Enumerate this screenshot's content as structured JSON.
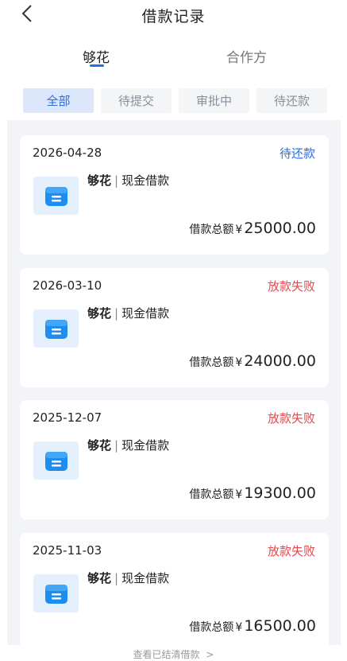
{
  "header": {
    "title": "借款记录",
    "back_icon": "chevron-left-icon"
  },
  "tabs": [
    {
      "label": "够花",
      "active": true
    },
    {
      "label": "合作方",
      "active": false
    }
  ],
  "filters": [
    {
      "label": "全部",
      "active": true
    },
    {
      "label": "待提交",
      "active": false
    },
    {
      "label": "审批中",
      "active": false
    },
    {
      "label": "待还款",
      "active": false
    }
  ],
  "records": [
    {
      "date": "2026-04-28",
      "status": "待还款",
      "status_type": "pending",
      "brand": "够花",
      "product": "现金借款",
      "total_label": "借款总额",
      "currency": "¥",
      "amount": "25000.00"
    },
    {
      "date": "2026-03-10",
      "status": "放款失败",
      "status_type": "failed",
      "brand": "够花",
      "product": "现金借款",
      "total_label": "借款总额",
      "currency": "¥",
      "amount": "24000.00"
    },
    {
      "date": "2025-12-07",
      "status": "放款失败",
      "status_type": "failed",
      "brand": "够花",
      "product": "现金借款",
      "total_label": "借款总额",
      "currency": "¥",
      "amount": "19300.00"
    },
    {
      "date": "2025-11-03",
      "status": "放款失败",
      "status_type": "failed",
      "brand": "够花",
      "product": "现金借款",
      "total_label": "借款总额",
      "currency": "¥",
      "amount": "16500.00"
    }
  ],
  "footer": {
    "label": "查看已结清借款",
    "arrow": ">"
  },
  "colors": {
    "accent": "#2a6de0",
    "failed": "#e5484d",
    "list_bg": "#f2f4f7",
    "logo_bg": "#e4f1fd"
  }
}
